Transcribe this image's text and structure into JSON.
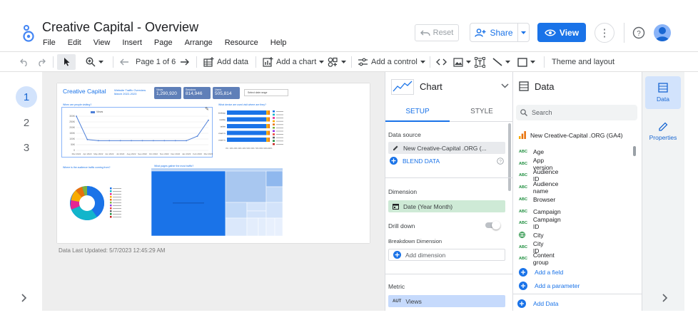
{
  "header": {
    "title": "Creative Capital - Overview",
    "menu": [
      "File",
      "Edit",
      "View",
      "Insert",
      "Page",
      "Arrange",
      "Resource",
      "Help"
    ],
    "reset_label": "Reset",
    "share_label": "Share",
    "view_label": "View"
  },
  "toolbar": {
    "page_indicator": "Page 1 of 6",
    "add_data": "Add data",
    "add_chart": "Add a chart",
    "add_control": "Add a control",
    "theme_layout": "Theme and layout"
  },
  "pages": [
    "1",
    "2",
    "3"
  ],
  "report": {
    "brand": "Creative Capital",
    "subtitle": "Website Traffic Overview",
    "date_range": "March 2022-2023",
    "kpis": [
      {
        "label": "Views",
        "value": "1,290,920"
      },
      {
        "label": "Sessions",
        "value": "814,946"
      },
      {
        "label": "Users",
        "value": "505,814"
      }
    ],
    "date_control": "Select date range",
    "q1": "When are people visiting?",
    "q2": "What device are used visit where are they?",
    "q3": "Where is the audience traffic coming from?",
    "q4": "What pages gather the most traffic?",
    "legend_label": "Views",
    "line_x": [
      "Mar 2022",
      "Apr 2022",
      "May 2022",
      "Jun 2022",
      "Jul 2022",
      "Aug 2022",
      "Sep 2022",
      "Oct 2022",
      "Nov 2022",
      "Dec 2022",
      "Jan 2023",
      "Feb 2023",
      "Mar 2023"
    ],
    "line_values": [
      305,
      95,
      85,
      85,
      85,
      85,
      85,
      85,
      85,
      85,
      85,
      125,
      265
    ],
    "y_ticks": [
      "300K",
      "250K",
      "200K",
      "150K",
      "100K",
      "50K",
      "0"
    ],
    "bar_rows": [
      "desktop",
      "mobile",
      "tablet",
      "smart tv",
      "smart tv"
    ],
    "bar_x_ticks": [
      "0%",
      "10%",
      "20%",
      "30%",
      "40%",
      "50%",
      "60%",
      "70%",
      "80%",
      "90%",
      "100%"
    ],
    "last_updated": "Data Last Updated: 5/7/2023 12:45:29 AM"
  },
  "chart_panel": {
    "title": "Chart",
    "tab_setup": "SETUP",
    "tab_style": "STYLE",
    "data_source_label": "Data source",
    "data_source": "New Creative-Capital .ORG (...",
    "blend_data": "BLEND DATA",
    "dimension_label": "Dimension",
    "dimension": "Date (Year Month)",
    "drill_down": "Drill down",
    "breakdown_label": "Breakdown Dimension",
    "add_dimension": "Add dimension",
    "metric_label": "Metric",
    "metric_type": "AUT",
    "metric": "Views"
  },
  "data_panel": {
    "title": "Data",
    "search_placeholder": "Search",
    "source": "New Creative-Capital .ORG (GA4)",
    "fields": [
      {
        "type": "ABC",
        "name": "Age"
      },
      {
        "type": "ABC",
        "name": "App version"
      },
      {
        "type": "ABC",
        "name": "Audience ID"
      },
      {
        "type": "ABC",
        "name": "Audience name"
      },
      {
        "type": "ABC",
        "name": "Browser"
      },
      {
        "type": "ABC",
        "name": "Campaign"
      },
      {
        "type": "ABC",
        "name": "Campaign ID"
      },
      {
        "type": "GEO",
        "name": "City"
      },
      {
        "type": "ABC",
        "name": "City ID"
      },
      {
        "type": "ABC",
        "name": "Content group"
      }
    ],
    "add_field": "Add a field",
    "add_parameter": "Add a parameter",
    "add_data": "Add Data"
  },
  "side_tabs": {
    "data": "Data",
    "properties": "Properties"
  },
  "colors": {
    "accent": "#1a73e8",
    "chart_blue": "#1a73e8",
    "cyan": "#12b5cb",
    "treemap_dark": "#1a73e8",
    "treemap_light": "#b9d3f5"
  }
}
